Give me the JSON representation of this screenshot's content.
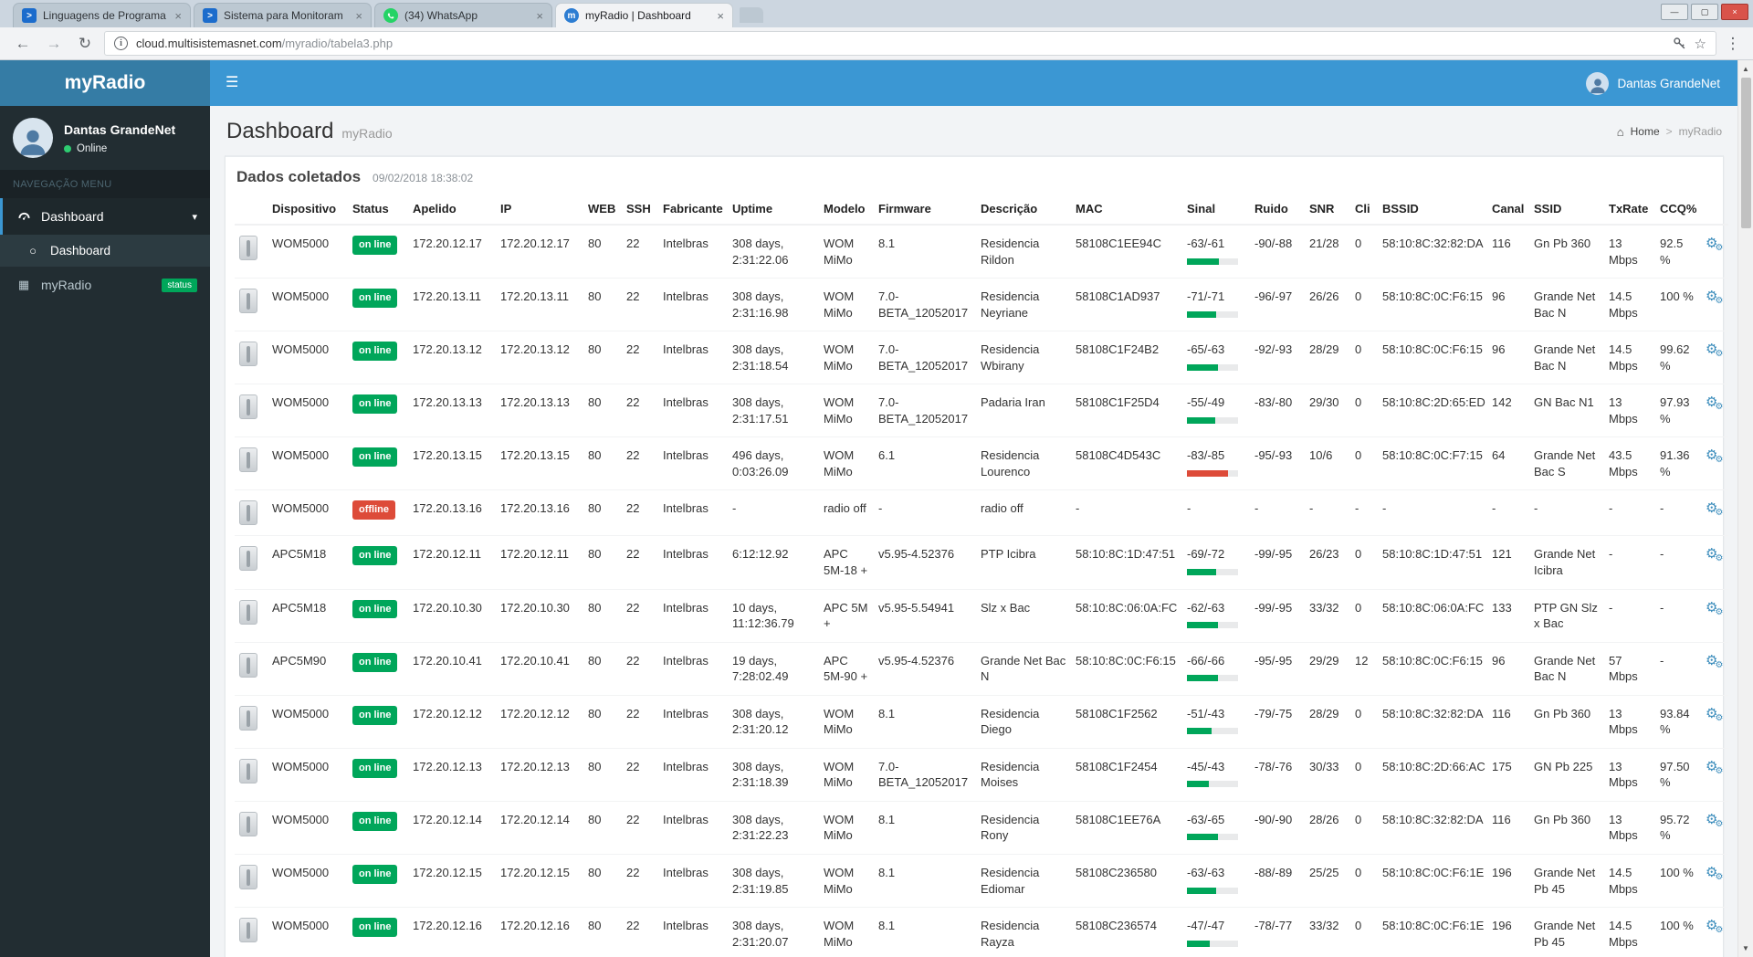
{
  "colors": {
    "header_blue": "#3b97d3",
    "logo_blue": "#357ca5",
    "sidebar_dark": "#222d32",
    "status_green": "#00a65a",
    "status_red": "#dd4b39",
    "accent_blue": "#3c8dbc"
  },
  "browser": {
    "tabs": [
      {
        "title": "Linguagens de Programa"
      },
      {
        "title": "Sistema para Monitoram"
      },
      {
        "title": "(34) WhatsApp"
      },
      {
        "title": "myRadio | Dashboard"
      }
    ],
    "url_host": "cloud.multisistemasnet.com",
    "url_path": "/myradio/tabela3.php"
  },
  "sidebar": {
    "brand": "myRadio",
    "user_name": "Dantas GrandeNet",
    "user_status": "Online",
    "nav_label": "NAVEGAÇÃO MENU",
    "menu": [
      {
        "label": "Dashboard"
      },
      {
        "label": "Dashboard"
      },
      {
        "label": "myRadio",
        "badge": "status"
      }
    ]
  },
  "header": {
    "user_name": "Dantas GrandeNet"
  },
  "page": {
    "title": "Dashboard",
    "subtitle": "myRadio",
    "breadcrumb_home": "Home",
    "breadcrumb_current": "myRadio",
    "box_title": "Dados coletados",
    "timestamp": "09/02/2018 18:38:02"
  },
  "table": {
    "columns": [
      {
        "key": "thumb",
        "label": "",
        "type": "thumb"
      },
      {
        "key": "dispositivo",
        "label": "Dispositivo",
        "type": "text"
      },
      {
        "key": "status",
        "label": "Status",
        "type": "badge"
      },
      {
        "key": "apelido",
        "label": "Apelido",
        "type": "text"
      },
      {
        "key": "ip",
        "label": "IP",
        "type": "text"
      },
      {
        "key": "web",
        "label": "WEB",
        "type": "text"
      },
      {
        "key": "ssh",
        "label": "SSH",
        "type": "text"
      },
      {
        "key": "fabricante",
        "label": "Fabricante",
        "type": "text"
      },
      {
        "key": "uptime",
        "label": "Uptime",
        "type": "text"
      },
      {
        "key": "modelo",
        "label": "Modelo",
        "type": "text"
      },
      {
        "key": "firmware",
        "label": "Firmware",
        "type": "text"
      },
      {
        "key": "descricao",
        "label": "Descrição",
        "type": "text"
      },
      {
        "key": "mac",
        "label": "MAC",
        "type": "text"
      },
      {
        "key": "sinal",
        "label": "Sinal",
        "type": "signal"
      },
      {
        "key": "ruido",
        "label": "Ruido",
        "type": "text"
      },
      {
        "key": "snr",
        "label": "SNR",
        "type": "text"
      },
      {
        "key": "cli",
        "label": "Cli",
        "type": "text"
      },
      {
        "key": "bssid",
        "label": "BSSID",
        "type": "text"
      },
      {
        "key": "canal",
        "label": "Canal",
        "type": "text"
      },
      {
        "key": "ssid",
        "label": "SSID",
        "type": "text"
      },
      {
        "key": "txrate",
        "label": "TxRate",
        "type": "text"
      },
      {
        "key": "ccq",
        "label": "CCQ%",
        "type": "text"
      },
      {
        "key": "actions",
        "label": "",
        "type": "gear"
      }
    ],
    "rows": [
      {
        "dispositivo": "WOM5000",
        "status": "on line",
        "apelido": "172.20.12.17",
        "ip": "172.20.12.17",
        "web": "80",
        "ssh": "22",
        "fabricante": "Intelbras",
        "uptime": "308 days, 2:31:22.06",
        "modelo": "WOM MiMo",
        "firmware": "8.1",
        "descricao": "Residencia Rildon",
        "mac": "58108C1EE94C",
        "sinal": "-63/-61",
        "sinal_bar": 62,
        "sinal_color": "green",
        "ruido": "-90/-88",
        "snr": "21/28",
        "cli": "0",
        "bssid": "58:10:8C:32:82:DA",
        "canal": "116",
        "ssid": "Gn Pb 360",
        "txrate": "13 Mbps",
        "ccq": "92.5 %"
      },
      {
        "dispositivo": "WOM5000",
        "status": "on line",
        "apelido": "172.20.13.11",
        "ip": "172.20.13.11",
        "web": "80",
        "ssh": "22",
        "fabricante": "Intelbras",
        "uptime": "308 days, 2:31:16.98",
        "modelo": "WOM MiMo",
        "firmware": "7.0-BETA_12052017",
        "descricao": "Residencia Neyriane",
        "mac": "58108C1AD937",
        "sinal": "-71/-71",
        "sinal_bar": 58,
        "sinal_color": "green",
        "ruido": "-96/-97",
        "snr": "26/26",
        "cli": "0",
        "bssid": "58:10:8C:0C:F6:15",
        "canal": "96",
        "ssid": "Grande Net Bac N",
        "txrate": "14.5 Mbps",
        "ccq": "100 %"
      },
      {
        "dispositivo": "WOM5000",
        "status": "on line",
        "apelido": "172.20.13.12",
        "ip": "172.20.13.12",
        "web": "80",
        "ssh": "22",
        "fabricante": "Intelbras",
        "uptime": "308 days, 2:31:18.54",
        "modelo": "WOM MiMo",
        "firmware": "7.0-BETA_12052017",
        "descricao": "Residencia Wbirany",
        "mac": "58108C1F24B2",
        "sinal": "-65/-63",
        "sinal_bar": 60,
        "sinal_color": "green",
        "ruido": "-92/-93",
        "snr": "28/29",
        "cli": "0",
        "bssid": "58:10:8C:0C:F6:15",
        "canal": "96",
        "ssid": "Grande Net Bac N",
        "txrate": "14.5 Mbps",
        "ccq": "99.62 %"
      },
      {
        "dispositivo": "WOM5000",
        "status": "on line",
        "apelido": "172.20.13.13",
        "ip": "172.20.13.13",
        "web": "80",
        "ssh": "22",
        "fabricante": "Intelbras",
        "uptime": "308 days, 2:31:17.51",
        "modelo": "WOM MiMo",
        "firmware": "7.0-BETA_12052017",
        "descricao": "Padaria Iran",
        "mac": "58108C1F25D4",
        "sinal": "-55/-49",
        "sinal_bar": 55,
        "sinal_color": "green",
        "ruido": "-83/-80",
        "snr": "29/30",
        "cli": "0",
        "bssid": "58:10:8C:2D:65:ED",
        "canal": "142",
        "ssid": "GN Bac N1",
        "txrate": "13 Mbps",
        "ccq": "97.93 %"
      },
      {
        "dispositivo": "WOM5000",
        "status": "on line",
        "apelido": "172.20.13.15",
        "ip": "172.20.13.15",
        "web": "80",
        "ssh": "22",
        "fabricante": "Intelbras",
        "uptime": "496 days, 0:03:26.09",
        "modelo": "WOM MiMo",
        "firmware": "6.1",
        "descricao": "Residencia Lourenco",
        "mac": "58108C4D543C",
        "sinal": "-83/-85",
        "sinal_bar": 80,
        "sinal_color": "red",
        "ruido": "-95/-93",
        "snr": "10/6",
        "cli": "0",
        "bssid": "58:10:8C:0C:F7:15",
        "canal": "64",
        "ssid": "Grande Net Bac S",
        "txrate": "43.5 Mbps",
        "ccq": "91.36 %"
      },
      {
        "dispositivo": "WOM5000",
        "status": "offline",
        "apelido": "172.20.13.16",
        "ip": "172.20.13.16",
        "web": "80",
        "ssh": "22",
        "fabricante": "Intelbras",
        "uptime": "-",
        "modelo": "radio off",
        "firmware": "-",
        "descricao": "radio off",
        "mac": "-",
        "sinal": "-",
        "sinal_bar": null,
        "sinal_color": "",
        "ruido": "-",
        "snr": "-",
        "cli": "-",
        "bssid": "-",
        "canal": "-",
        "ssid": "-",
        "txrate": "-",
        "ccq": "-"
      },
      {
        "dispositivo": "APC5M18",
        "status": "on line",
        "apelido": "172.20.12.11",
        "ip": "172.20.12.11",
        "web": "80",
        "ssh": "22",
        "fabricante": "Intelbras",
        "uptime": "6:12:12.92",
        "modelo": "APC 5M-18 +",
        "firmware": "v5.95-4.52376",
        "descricao": "PTP Icibra",
        "mac": "58:10:8C:1D:47:51",
        "sinal": "-69/-72",
        "sinal_bar": 58,
        "sinal_color": "green",
        "ruido": "-99/-95",
        "snr": "26/23",
        "cli": "0",
        "bssid": "58:10:8C:1D:47:51",
        "canal": "121",
        "ssid": "Grande Net Icibra",
        "txrate": "-",
        "ccq": "-"
      },
      {
        "dispositivo": "APC5M18",
        "status": "on line",
        "apelido": "172.20.10.30",
        "ip": "172.20.10.30",
        "web": "80",
        "ssh": "22",
        "fabricante": "Intelbras",
        "uptime": "10 days, 11:12:36.79",
        "modelo": "APC 5M +",
        "firmware": "v5.95-5.54941",
        "descricao": "Slz x Bac",
        "mac": "58:10:8C:06:0A:FC",
        "sinal": "-62/-63",
        "sinal_bar": 60,
        "sinal_color": "green",
        "ruido": "-99/-95",
        "snr": "33/32",
        "cli": "0",
        "bssid": "58:10:8C:06:0A:FC",
        "canal": "133",
        "ssid": "PTP GN Slz x Bac",
        "txrate": "-",
        "ccq": "-"
      },
      {
        "dispositivo": "APC5M90",
        "status": "on line",
        "apelido": "172.20.10.41",
        "ip": "172.20.10.41",
        "web": "80",
        "ssh": "22",
        "fabricante": "Intelbras",
        "uptime": "19 days, 7:28:02.49",
        "modelo": "APC 5M-90 +",
        "firmware": "v5.95-4.52376",
        "descricao": "Grande Net Bac N",
        "mac": "58:10:8C:0C:F6:15",
        "sinal": "-66/-66",
        "sinal_bar": 60,
        "sinal_color": "green",
        "ruido": "-95/-95",
        "snr": "29/29",
        "cli": "12",
        "bssid": "58:10:8C:0C:F6:15",
        "canal": "96",
        "ssid": "Grande Net Bac N",
        "txrate": "57 Mbps",
        "ccq": "-"
      },
      {
        "dispositivo": "WOM5000",
        "status": "on line",
        "apelido": "172.20.12.12",
        "ip": "172.20.12.12",
        "web": "80",
        "ssh": "22",
        "fabricante": "Intelbras",
        "uptime": "308 days, 2:31:20.12",
        "modelo": "WOM MiMo",
        "firmware": "8.1",
        "descricao": "Residencia Diego",
        "mac": "58108C1F2562",
        "sinal": "-51/-43",
        "sinal_bar": 48,
        "sinal_color": "green",
        "ruido": "-79/-75",
        "snr": "28/29",
        "cli": "0",
        "bssid": "58:10:8C:32:82:DA",
        "canal": "116",
        "ssid": "Gn Pb 360",
        "txrate": "13 Mbps",
        "ccq": "93.84 %"
      },
      {
        "dispositivo": "WOM5000",
        "status": "on line",
        "apelido": "172.20.12.13",
        "ip": "172.20.12.13",
        "web": "80",
        "ssh": "22",
        "fabricante": "Intelbras",
        "uptime": "308 days, 2:31:18.39",
        "modelo": "WOM MiMo",
        "firmware": "7.0-BETA_12052017",
        "descricao": "Residencia Moises",
        "mac": "58108C1F2454",
        "sinal": "-45/-43",
        "sinal_bar": 42,
        "sinal_color": "green",
        "ruido": "-78/-76",
        "snr": "30/33",
        "cli": "0",
        "bssid": "58:10:8C:2D:66:AC",
        "canal": "175",
        "ssid": "GN Pb 225",
        "txrate": "13 Mbps",
        "ccq": "97.50 %"
      },
      {
        "dispositivo": "WOM5000",
        "status": "on line",
        "apelido": "172.20.12.14",
        "ip": "172.20.12.14",
        "web": "80",
        "ssh": "22",
        "fabricante": "Intelbras",
        "uptime": "308 days, 2:31:22.23",
        "modelo": "WOM MiMo",
        "firmware": "8.1",
        "descricao": "Residencia Rony",
        "mac": "58108C1EE76A",
        "sinal": "-63/-65",
        "sinal_bar": 60,
        "sinal_color": "green",
        "ruido": "-90/-90",
        "snr": "28/26",
        "cli": "0",
        "bssid": "58:10:8C:32:82:DA",
        "canal": "116",
        "ssid": "Gn Pb 360",
        "txrate": "13 Mbps",
        "ccq": "95.72 %"
      },
      {
        "dispositivo": "WOM5000",
        "status": "on line",
        "apelido": "172.20.12.15",
        "ip": "172.20.12.15",
        "web": "80",
        "ssh": "22",
        "fabricante": "Intelbras",
        "uptime": "308 days, 2:31:19.85",
        "modelo": "WOM MiMo",
        "firmware": "8.1",
        "descricao": "Residencia Ediomar",
        "mac": "58108C236580",
        "sinal": "-63/-63",
        "sinal_bar": 58,
        "sinal_color": "green",
        "ruido": "-88/-89",
        "snr": "25/25",
        "cli": "0",
        "bssid": "58:10:8C:0C:F6:1E",
        "canal": "196",
        "ssid": "Grande Net Pb 45",
        "txrate": "14.5 Mbps",
        "ccq": "100 %"
      },
      {
        "dispositivo": "WOM5000",
        "status": "on line",
        "apelido": "172.20.12.16",
        "ip": "172.20.12.16",
        "web": "80",
        "ssh": "22",
        "fabricante": "Intelbras",
        "uptime": "308 days, 2:31:20.07",
        "modelo": "WOM MiMo",
        "firmware": "8.1",
        "descricao": "Residencia Rayza",
        "mac": "58108C236574",
        "sinal": "-47/-47",
        "sinal_bar": 44,
        "sinal_color": "green",
        "ruido": "-78/-77",
        "snr": "33/32",
        "cli": "0",
        "bssid": "58:10:8C:0C:F6:1E",
        "canal": "196",
        "ssid": "Grande Net Pb 45",
        "txrate": "14.5 Mbps",
        "ccq": "100 %"
      }
    ]
  }
}
